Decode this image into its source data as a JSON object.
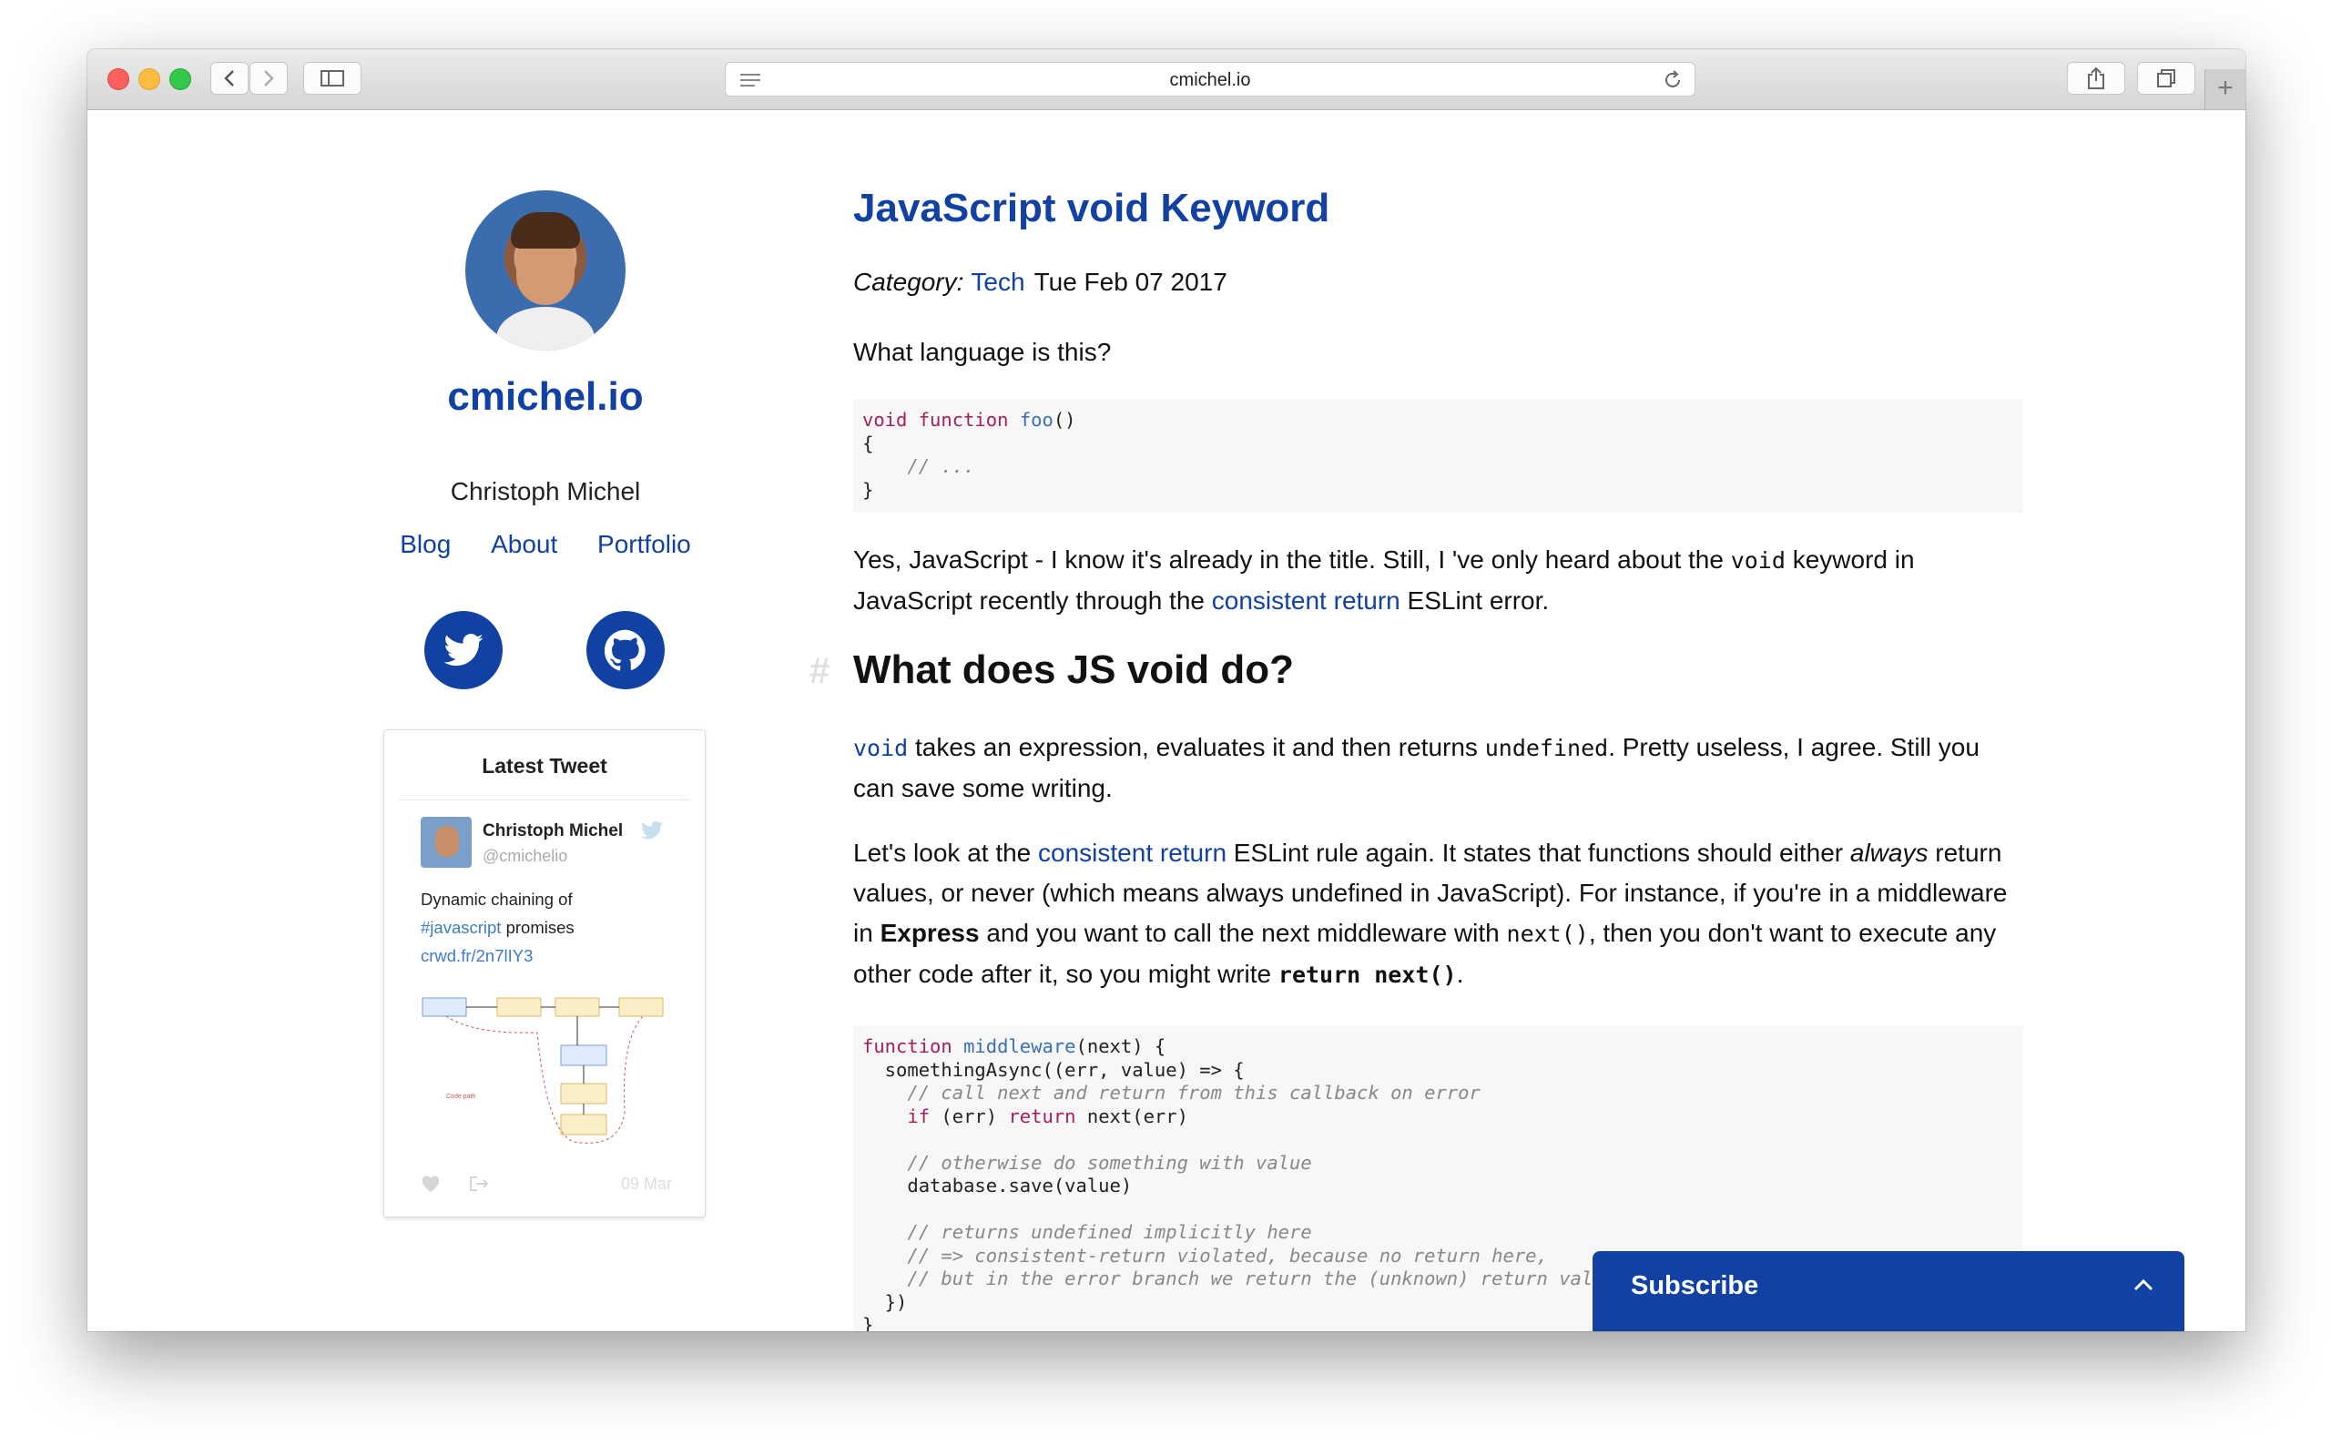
{
  "browser": {
    "url": "cmichel.io"
  },
  "sidebar": {
    "site_title": "cmichel.io",
    "author": "Christoph Michel",
    "nav": [
      "Blog",
      "About",
      "Portfolio"
    ],
    "social": [
      "twitter-icon",
      "github-icon"
    ],
    "tweet_widget": {
      "header": "Latest Tweet",
      "name": "Christoph Michel",
      "handle": "@cmichelio",
      "text_line1": "Dynamic chaining of",
      "hashtag": "#javascript",
      "text_line2_rest": " promises",
      "link": "crwd.fr/2n7lIY3",
      "image_labels": {
        "code_path": "Code path"
      },
      "date": "09 Mar"
    }
  },
  "article": {
    "title": "JavaScript void Keyword",
    "category_label": "Category:",
    "category": "Tech",
    "date": "Tue Feb 07 2017",
    "intro": "What language is this?",
    "code1": {
      "l1_kw1": "void",
      "l1_kw2": "function",
      "l1_fn": "foo",
      "l1_rest": "()",
      "l2": "{",
      "l3": "    // ...",
      "l4": "}"
    },
    "para2": {
      "t1": "Yes, JavaScript - I know it's already in the title. Still, I 've only heard about the ",
      "code": "void",
      "t2": " keyword in JavaScript recently through the ",
      "link": "consistent return",
      "t3": " ESLint error."
    },
    "h2": "What does JS void do?",
    "h2_anchor": "#",
    "para3": {
      "code1": "void",
      "t1": " takes an expression, evaluates it and then returns ",
      "code2": "undefined",
      "t2": ". Pretty useless, I agree. Still you can save some writing."
    },
    "para4": {
      "t1": "Let's look at the ",
      "link": "consistent return",
      "t2": " ESLint rule again. It states that functions should either ",
      "em": "always",
      "t3": " return values, or never (which means always undefined in JavaScript). For instance, if you're in a middleware in ",
      "strong": "Express",
      "t4": " and you want to call the next middleware with ",
      "code1": "next()",
      "t5": ", then you don't want to execute any other code after it, so you might write ",
      "code2": "return next()",
      "t6": "."
    },
    "code2": {
      "l1_kw": "function",
      "l1_fn": "middleware",
      "l1_rest": "(next) {",
      "l2": "  somethingAsync((err, value) => {",
      "l3": "    // call next and return from this callback on error",
      "l4_kw1": "if",
      "l4_mid": " (err) ",
      "l4_kw2": "return",
      "l4_rest": " next(err)",
      "l6": "    // otherwise do something with value",
      "l7": "    database.save(value)",
      "l9": "    // returns undefined implicitly here",
      "l10": "    // => consistent-return violated, because no return here,",
      "l11": "    // but in the error branch we return the (unknown) return value of next",
      "l12": "  })",
      "l13": "}"
    }
  },
  "subscribe": {
    "label": "Subscribe"
  }
}
